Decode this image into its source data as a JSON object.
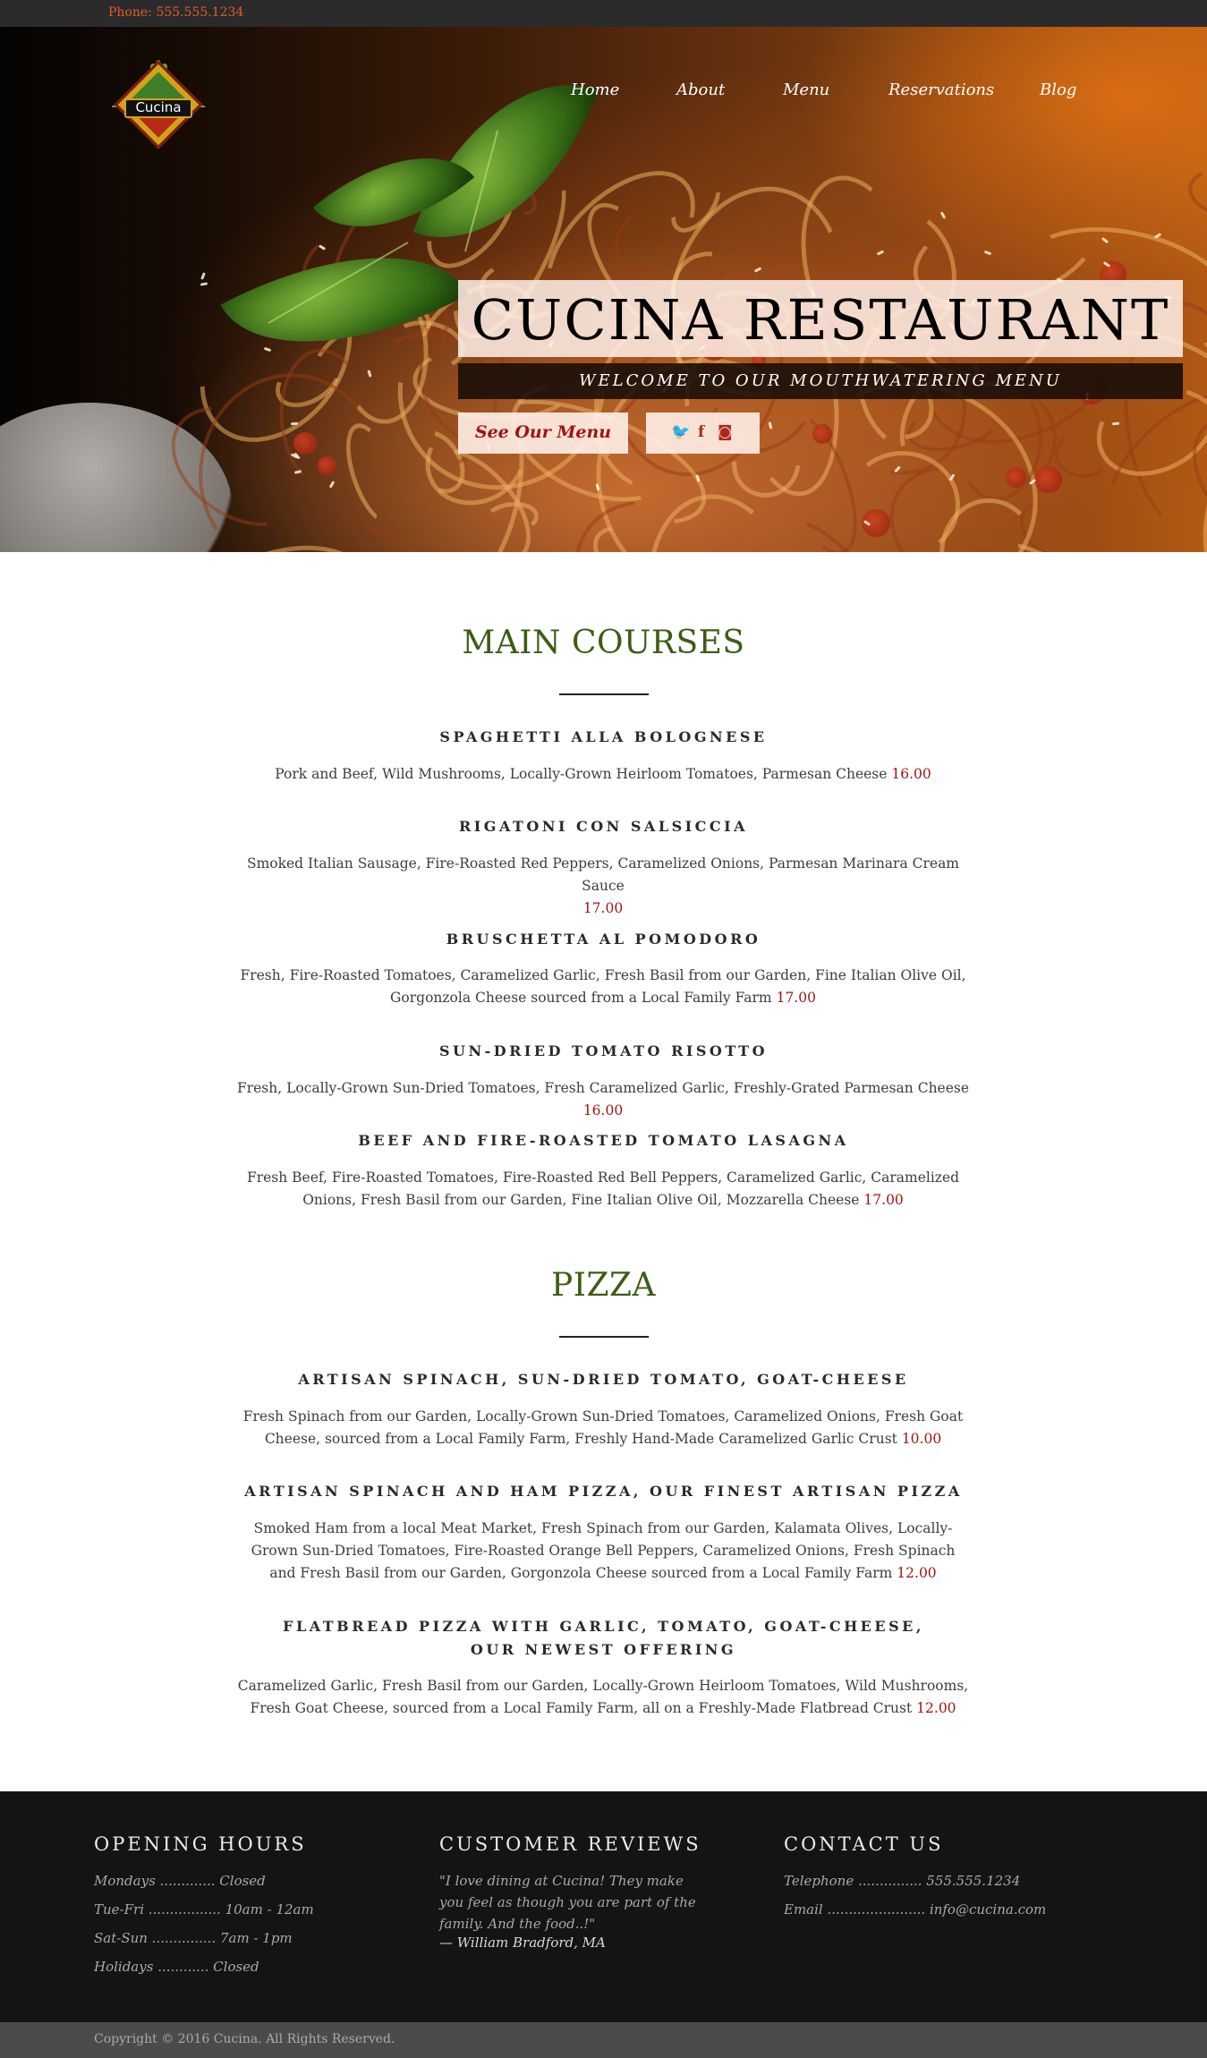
{
  "topbar": {
    "phone": "Phone: 555.555.1234"
  },
  "logo": {
    "name": "Cucina"
  },
  "nav": [
    "Home",
    "About",
    "Menu",
    "Reservations",
    "Blog"
  ],
  "hero": {
    "title": "CUCINA RESTAURANT",
    "subtitle": "WELCOME TO OUR MOUTHWATERING MENU",
    "menu_button": "See Our Menu",
    "social_icons": [
      "twitter-icon",
      "facebook-icon",
      "instagram-icon"
    ],
    "social_glyphs": {
      "twitter": "🐦",
      "facebook": "f",
      "instagram": "◙"
    }
  },
  "menu": {
    "main_courses": {
      "title": "MAIN COURSES",
      "items": [
        {
          "name": "SPAGHETTI ALLA BOLOGNESE",
          "desc": "Pork and Beef, Wild Mushrooms, Locally-Grown Heirloom Tomatoes, Parmesan Cheese",
          "price": "16.00"
        },
        {
          "name": "RIGATONI CON SALSICCIA",
          "desc": "Smoked Italian Sausage, Fire-Roasted Red Peppers, Caramelized Onions, Parmesan Marinara Cream Sauce",
          "price": "17.00"
        },
        {
          "name": "BRUSCHETTA AL POMODORO",
          "desc": "Fresh, Fire-Roasted Tomatoes, Caramelized Garlic, Fresh Basil from our Garden, Fine Italian Olive Oil, Gorgonzola Cheese sourced from a Local Family Farm",
          "price": "17.00"
        },
        {
          "name": "SUN-DRIED TOMATO RISOTTO",
          "desc": "Fresh, Locally-Grown Sun-Dried Tomatoes, Fresh Caramelized Garlic, Freshly-Grated Parmesan Cheese",
          "price": "16.00"
        },
        {
          "name": "BEEF AND FIRE-ROASTED TOMATO LASAGNA",
          "desc": "Fresh Beef, Fire-Roasted Tomatoes, Fire-Roasted Red Bell Peppers, Caramelized Garlic, Caramelized Onions, Fresh Basil from our Garden, Fine Italian Olive Oil, Mozzarella Cheese",
          "price": "17.00"
        }
      ]
    },
    "pizza": {
      "title": "PIZZA",
      "items": [
        {
          "name": "ARTISAN SPINACH, SUN-DRIED TOMATO, GOAT-CHEESE",
          "desc": "Fresh Spinach from our Garden, Locally-Grown Sun-Dried Tomatoes, Caramelized Onions, Fresh Goat Cheese, sourced from a Local Family Farm, Freshly Hand-Made Caramelized Garlic Crust",
          "price": "10.00"
        },
        {
          "name": "ARTISAN SPINACH AND HAM PIZZA, OUR FINEST ARTISAN PIZZA",
          "desc": "Smoked Ham from a local Meat Market, Fresh Spinach from our Garden, Kalamata Olives, Locally-Grown Sun-Dried Tomatoes, Fire-Roasted Orange Bell Peppers, Caramelized Onions, Fresh Spinach and Fresh Basil from our Garden, Gorgonzola Cheese sourced from a Local Family Farm",
          "price": "12.00"
        },
        {
          "name_line1": "FLATBREAD PIZZA WITH GARLIC, TOMATO, GOAT-CHEESE,",
          "name_line2": "OUR NEWEST OFFERING",
          "desc": "Caramelized Garlic, Fresh Basil from our Garden, Locally-Grown Heirloom Tomatoes, Wild Mushrooms, Fresh Goat Cheese, sourced from a Local Family Farm, all on a Freshly-Made Flatbread Crust",
          "price": "12.00"
        }
      ]
    }
  },
  "footer": {
    "hours": {
      "title": "OPENING HOURS",
      "lines": [
        "Mondays ............. Closed",
        "Tue-Fri ................. 10am - 12am",
        "Sat-Sun ............... 7am - 1pm",
        "Holidays ............ Closed"
      ]
    },
    "reviews": {
      "title": "CUSTOMER REVIEWS",
      "quote": "\"I love dining at Cucina! They make you feel as though you are part of the family. And the food..!\"",
      "author": "— William Bradford, MA"
    },
    "contact": {
      "title": "CONTACT US",
      "lines": [
        "Telephone ............... 555.555.1234",
        "Email ....................... info@cucina.com"
      ]
    }
  },
  "copyright": "Copyright © 2016 Cucina. All Rights Reserved.",
  "colors": {
    "accent_green": "#3d5c14",
    "price_red": "#9d1414",
    "phone_orange": "#e35a2a",
    "footer_bg": "#141414"
  }
}
